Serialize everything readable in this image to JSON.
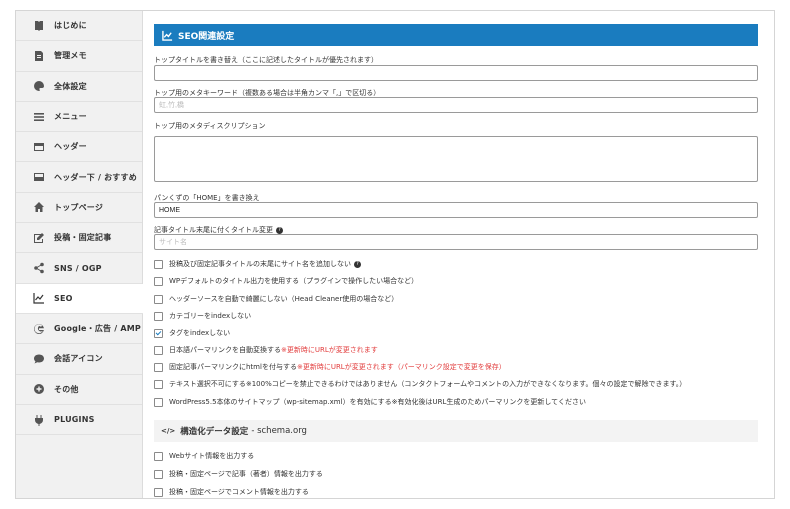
{
  "sidebar": {
    "items": [
      {
        "label": "はじめに",
        "icon": "book-icon"
      },
      {
        "label": "管理メモ",
        "icon": "memo-icon"
      },
      {
        "label": "全体設定",
        "icon": "palette-icon"
      },
      {
        "label": "メニュー",
        "icon": "menu-icon"
      },
      {
        "label": "ヘッダー",
        "icon": "header-icon"
      },
      {
        "label": "ヘッダー下 / おすすめ",
        "icon": "header-below-icon"
      },
      {
        "label": "トップページ",
        "icon": "home-icon"
      },
      {
        "label": "投稿・固定記事",
        "icon": "edit-icon"
      },
      {
        "label": "SNS / OGP",
        "icon": "share-icon"
      },
      {
        "label": "SEO",
        "icon": "chart-icon"
      },
      {
        "label": "Google・広告 / AMP",
        "icon": "google-icon"
      },
      {
        "label": "会話アイコン",
        "icon": "chat-icon"
      },
      {
        "label": "その他",
        "icon": "plus-circle-icon"
      },
      {
        "label": "PLUGINS",
        "icon": "plug-icon"
      }
    ],
    "active_index": 9
  },
  "main": {
    "section_title": "SEO関連設定",
    "fields": {
      "top_title_label": "トップタイトルを書き替え（ここに記述したタイトルが優先されます）",
      "top_title_value": "",
      "top_keywords_label": "トップ用のメタキーワード（複数ある場合は半角カンマ「,」で区切る）",
      "top_keywords_placeholder": "虹,竹,橋",
      "top_description_label": "トップ用のメタディスクリプション",
      "breadcrumb_label": "パンくずの「HOME」を書き換え",
      "breadcrumb_value": "HOME",
      "title_suffix_label": "記事タイトル末尾に付くタイトル変更",
      "title_suffix_placeholder": "サイト名"
    },
    "checkboxes": [
      {
        "label": "投稿及び固定記事タイトルの末尾にサイト名を追加しない",
        "note": "",
        "help": true,
        "checked": false
      },
      {
        "label": "WPデフォルトのタイトル出力を使用する（プラグインで操作したい場合など）",
        "note": "",
        "help": false,
        "checked": false
      },
      {
        "label": "ヘッダーソースを自動で綺麗にしない（Head Cleaner使用の場合など）",
        "note": "",
        "help": false,
        "checked": false
      },
      {
        "label": "カテゴリーをindexしない",
        "note": "",
        "help": false,
        "checked": false
      },
      {
        "label": "タグをindexしない",
        "note": "",
        "help": false,
        "checked": true
      },
      {
        "label": "日本語パーマリンクを自動変換する",
        "note": "※更新時にURLが変更されます",
        "help": false,
        "checked": false
      },
      {
        "label": "固定記事パーマリンクにhtmlを付与する",
        "note": "※更新時にURLが変更されます（パーマリンク設定で変更を保存）",
        "help": false,
        "checked": false
      },
      {
        "label": "テキスト選択不可にする※100%コピーを禁止できるわけではありません（コンタクトフォームやコメントの入力ができなくなります。個々の設定で解除できます。）",
        "note": "",
        "help": false,
        "checked": false
      },
      {
        "label": "WordPress5.5本体のサイトマップ（wp-sitemap.xml）を有効にする※有効化後はURL生成のためパーマリンクを更新してください",
        "note": "",
        "help": false,
        "checked": false
      }
    ],
    "schema": {
      "tag": "</>",
      "title": "構造化データ設定",
      "subtitle": "- schema.org",
      "checkboxes": [
        {
          "label": "Webサイト情報を出力する",
          "checked": false
        },
        {
          "label": "投稿・固定ページで記事（著者）情報を出力する",
          "checked": false
        },
        {
          "label": "投稿・固定ページでコメント情報を出力する",
          "checked": false
        }
      ]
    }
  },
  "colors": {
    "accent": "#1a7cbf",
    "note_red": "#e23b3b"
  }
}
